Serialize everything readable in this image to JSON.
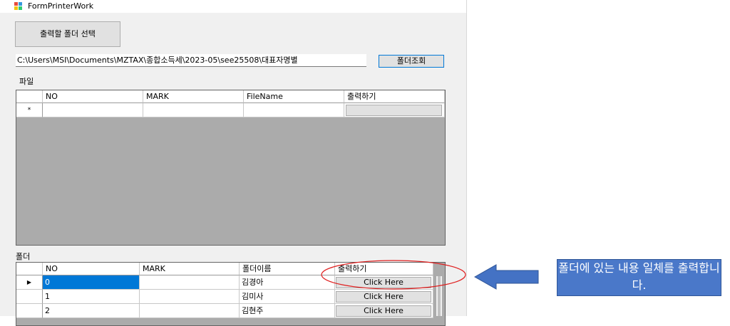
{
  "window": {
    "title": "FormPrinterWork"
  },
  "toolbar": {
    "select_folder_label": "출력할 폴더 선택",
    "path_value": "C:\\Users\\MSI\\Documents\\MZTAX\\종합소득세\\2023-05\\see25508\\대표자명별",
    "lookup_label": "폴더조회"
  },
  "file_section": {
    "label": "파일",
    "columns": [
      "NO",
      "MARK",
      "FileName",
      "출력하기"
    ],
    "new_row_marker": "*"
  },
  "folder_section": {
    "label": "폴더",
    "columns": [
      "NO",
      "MARK",
      "폴더이름",
      "출력하기"
    ],
    "rows": [
      {
        "no": "0",
        "mark": "",
        "name": "김경아",
        "action": "Click Here",
        "current": true
      },
      {
        "no": "1",
        "mark": "",
        "name": "김미사",
        "action": "Click Here",
        "current": false
      },
      {
        "no": "2",
        "mark": "",
        "name": "김현주",
        "action": "Click Here",
        "current": false
      }
    ],
    "current_row_marker": "▶"
  },
  "annotation": {
    "text": "폴더에 있는 내용 일체를 출력합니다.",
    "colors": {
      "ellipse": "#e02020",
      "arrow_fill": "#4472c4",
      "arrow_stroke": "#2f5597",
      "box": "#4a78c9"
    }
  }
}
